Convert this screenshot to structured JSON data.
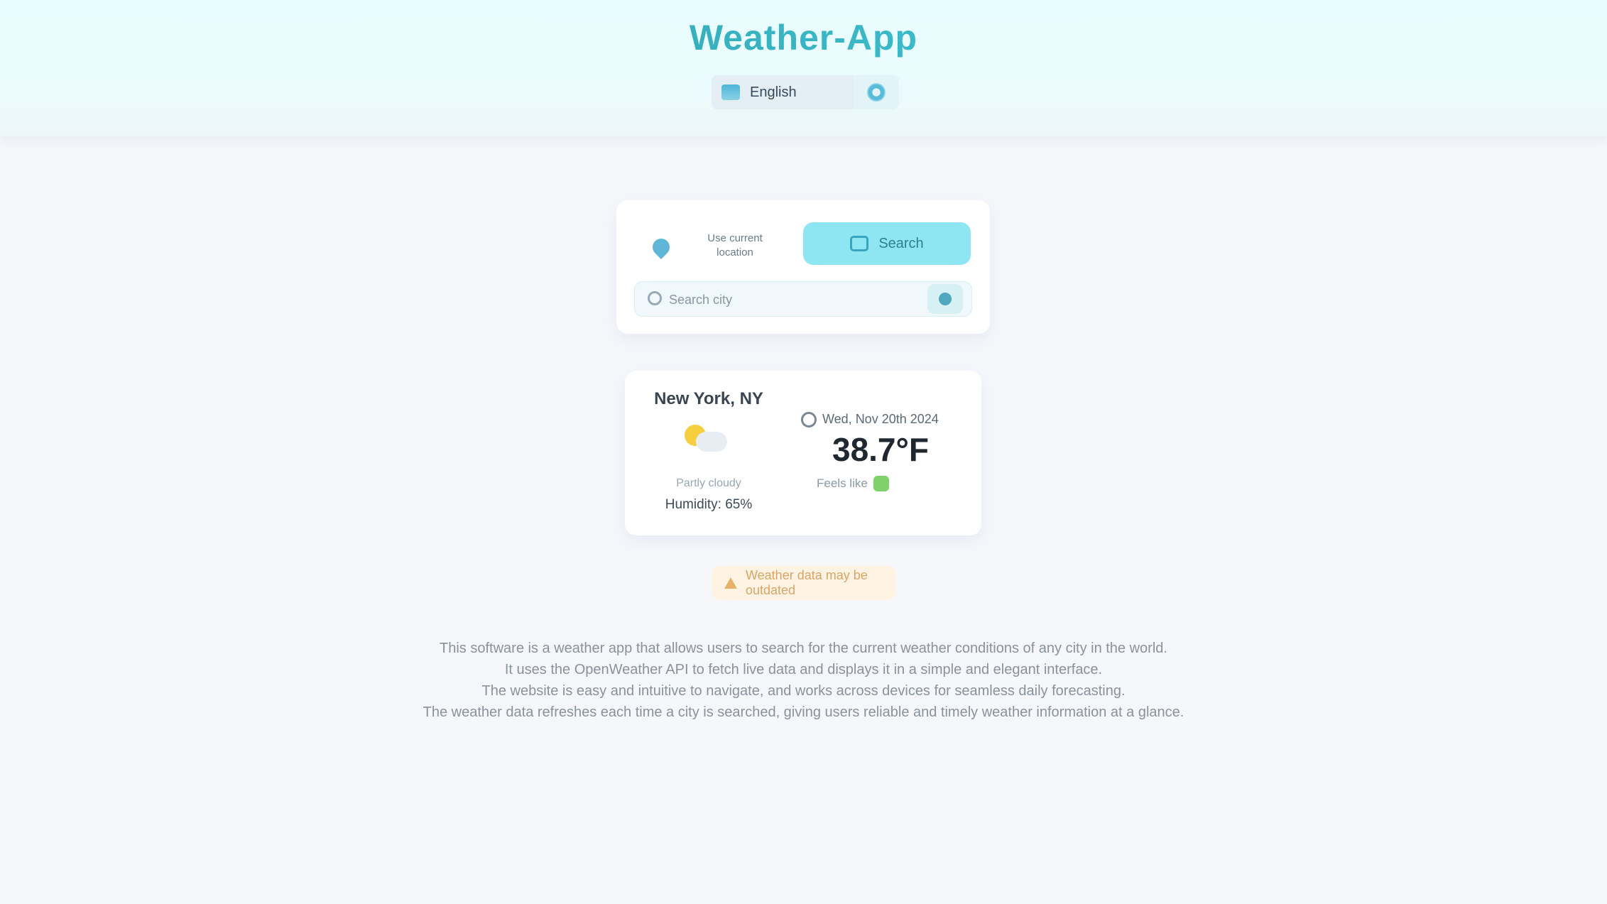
{
  "header": {
    "title": "Weather-App",
    "language_label": "English",
    "icons": {
      "flag": "flag-icon",
      "settings": "gear-icon"
    }
  },
  "search": {
    "location_text": "Use current location",
    "search_button_label": "Search",
    "input_placeholder": "Search city",
    "icons": {
      "location": "pin-icon",
      "search": "search-icon",
      "submit": "arrow-icon"
    }
  },
  "weather": {
    "city": "New York, NY",
    "condition_label": "Partly cloudy",
    "condition_desc": "Humidity: 65%",
    "date": "Wed, Nov 20th 2024",
    "temperature": "38.7°F",
    "feels_like": "Feels like",
    "icons": {
      "weather": "partly-cloudy-icon",
      "time": "clock-icon"
    },
    "colors": {
      "sun": "#f5cf3d",
      "feels_indicator": "#7fd16a"
    }
  },
  "notice": {
    "text": "Weather data may be outdated",
    "icon": "warning-icon",
    "color": "#d8a566"
  },
  "description": {
    "lines": [
      "This software is a weather app that allows users to search for the current weather conditions of any city in the world.",
      "It uses the OpenWeather API to fetch live data and displays it in a simple and elegant interface.",
      "The website is easy and intuitive to navigate, and works across devices for seamless daily forecasting.",
      "The weather data refreshes each time a city is searched, giving users reliable and timely weather information at a glance."
    ]
  },
  "theme": {
    "accent": "#44cfe0",
    "accent_dark": "#2d8f9a",
    "background": "#f5f7fb"
  }
}
